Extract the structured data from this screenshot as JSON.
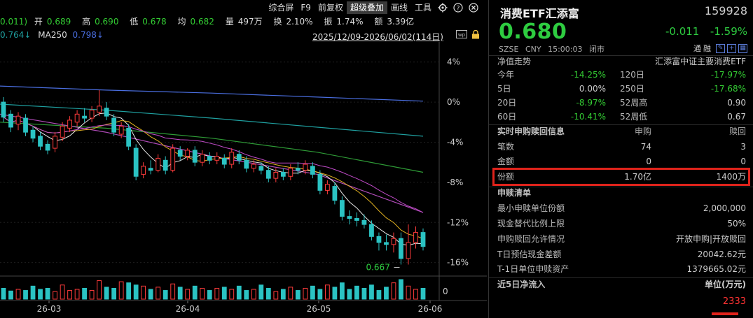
{
  "toolbar": {
    "items": [
      "综合屏",
      "F9",
      "前复权",
      "超级叠加",
      "画线",
      "工具"
    ],
    "active_index": 3,
    "icons": [
      "gear-icon",
      "help-icon",
      "close-icon"
    ]
  },
  "quote": {
    "prev_partial": "0.011)",
    "open_label": "开",
    "open": "0.689",
    "high_label": "高",
    "high": "0.690",
    "low_label": "低",
    "low": "0.678",
    "avg_label": "均",
    "avg": "0.682",
    "vol_label": "量",
    "vol": "497万",
    "turnover_label": "换",
    "turnover": "2.10%",
    "amp_label": "振",
    "amp": "1.74%",
    "amount_label": "额",
    "amount": "3.39亿"
  },
  "ma": {
    "partial_value": "0.764↓",
    "ma250_label": "MA250",
    "ma250_value": "0.798↓"
  },
  "range": {
    "text": "2025/12/09-2026/06/02(114日)",
    "icons": [
      "wp-icon",
      "lock-icon"
    ]
  },
  "axis": {
    "y_ticks": [
      "4%",
      "0%",
      "-4%",
      "-8%",
      "-12%",
      "-16%"
    ],
    "x_ticks": [
      "26-03",
      "26-04",
      "26-05",
      "26-06"
    ],
    "volume_zero": "0",
    "low_marker": "0.667"
  },
  "chart_data": {
    "type": "candlestick",
    "y_range_pct": [
      -17,
      6
    ],
    "candles": [
      {
        "o": 0.0,
        "c": -1.5,
        "h": 0.5,
        "l": -2.0
      },
      {
        "o": -1.2,
        "c": -2.5,
        "h": -0.8,
        "l": -3.0
      },
      {
        "o": -2.2,
        "c": -1.4,
        "h": -1.0,
        "l": -2.8
      },
      {
        "o": -1.6,
        "c": -3.0,
        "h": -1.2,
        "l": -3.4
      },
      {
        "o": -2.8,
        "c": -3.6,
        "h": -2.4,
        "l": -4.0
      },
      {
        "o": -3.4,
        "c": -4.4,
        "h": -3.0,
        "l": -4.8
      },
      {
        "o": -4.2,
        "c": -4.8,
        "h": -3.8,
        "l": -5.2
      },
      {
        "o": -4.6,
        "c": -3.4,
        "h": -3.0,
        "l": -5.0
      },
      {
        "o": -3.5,
        "c": -2.4,
        "h": -2.0,
        "l": -3.9
      },
      {
        "o": -2.6,
        "c": -1.8,
        "h": -1.4,
        "l": -3.0
      },
      {
        "o": -2.0,
        "c": -1.2,
        "h": -0.8,
        "l": -2.4
      },
      {
        "o": -1.4,
        "c": -1.6,
        "h": -0.6,
        "l": -2.0
      },
      {
        "o": -1.6,
        "c": -0.8,
        "h": -0.4,
        "l": -2.0
      },
      {
        "o": -1.0,
        "c": -0.4,
        "h": 1.2,
        "l": -1.4
      },
      {
        "o": -0.6,
        "c": -1.4,
        "h": 0.0,
        "l": -1.8
      },
      {
        "o": -1.6,
        "c": -3.0,
        "h": -1.2,
        "l": -3.4
      },
      {
        "o": -3.2,
        "c": -2.4,
        "h": -2.0,
        "l": -3.6
      },
      {
        "o": -2.6,
        "c": -4.4,
        "h": -2.2,
        "l": -4.8
      },
      {
        "o": -4.6,
        "c": -7.4,
        "h": -4.2,
        "l": -7.8
      },
      {
        "o": -7.2,
        "c": -6.4,
        "h": -6.0,
        "l": -7.6
      },
      {
        "o": -6.6,
        "c": -6.8,
        "h": -5.8,
        "l": -7.2
      },
      {
        "o": -6.8,
        "c": -5.6,
        "h": -5.2,
        "l": -7.0
      },
      {
        "o": -5.8,
        "c": -6.8,
        "h": -5.4,
        "l": -7.2
      },
      {
        "o": -6.8,
        "c": -4.6,
        "h": -4.2,
        "l": -7.0
      },
      {
        "o": -4.8,
        "c": -5.4,
        "h": -4.4,
        "l": -5.8
      },
      {
        "o": -5.4,
        "c": -4.8,
        "h": -4.6,
        "l": -5.8
      },
      {
        "o": -4.8,
        "c": -6.0,
        "h": -4.4,
        "l": -6.4
      },
      {
        "o": -6.0,
        "c": -5.2,
        "h": -4.8,
        "l": -6.4
      },
      {
        "o": -5.4,
        "c": -5.8,
        "h": -5.0,
        "l": -6.2
      },
      {
        "o": -5.8,
        "c": -5.4,
        "h": -5.0,
        "l": -6.2
      },
      {
        "o": -5.6,
        "c": -6.2,
        "h": -5.2,
        "l": -6.6
      },
      {
        "o": -6.2,
        "c": -5.0,
        "h": -4.6,
        "l": -6.6
      },
      {
        "o": -5.2,
        "c": -5.8,
        "h": -4.8,
        "l": -6.2
      },
      {
        "o": -5.8,
        "c": -6.6,
        "h": -5.4,
        "l": -7.0
      },
      {
        "o": -6.6,
        "c": -6.2,
        "h": -5.8,
        "l": -7.0
      },
      {
        "o": -6.4,
        "c": -6.8,
        "h": -6.0,
        "l": -7.2
      },
      {
        "o": -6.8,
        "c": -7.6,
        "h": -6.4,
        "l": -8.0
      },
      {
        "o": -7.6,
        "c": -7.0,
        "h": -6.6,
        "l": -8.0
      },
      {
        "o": -7.0,
        "c": -7.4,
        "h": -6.6,
        "l": -7.8
      },
      {
        "o": -7.4,
        "c": -6.6,
        "h": -6.2,
        "l": -7.8
      },
      {
        "o": -6.6,
        "c": -6.8,
        "h": -6.0,
        "l": -7.2
      },
      {
        "o": -6.8,
        "c": -6.2,
        "h": -5.8,
        "l": -7.2
      },
      {
        "o": -6.4,
        "c": -7.2,
        "h": -6.0,
        "l": -7.6
      },
      {
        "o": -7.2,
        "c": -8.8,
        "h": -6.8,
        "l": -9.2
      },
      {
        "o": -8.8,
        "c": -8.2,
        "h": -7.8,
        "l": -9.2
      },
      {
        "o": -8.4,
        "c": -9.8,
        "h": -8.0,
        "l": -10.2
      },
      {
        "o": -9.8,
        "c": -11.4,
        "h": -9.4,
        "l": -11.8
      },
      {
        "o": -11.4,
        "c": -11.6,
        "h": -10.8,
        "l": -12.2
      },
      {
        "o": -11.6,
        "c": -11.8,
        "h": -11.0,
        "l": -12.4
      },
      {
        "o": -11.8,
        "c": -12.2,
        "h": -11.2,
        "l": -12.6
      },
      {
        "o": -12.2,
        "c": -13.4,
        "h": -11.8,
        "l": -13.8
      },
      {
        "o": -13.4,
        "c": -14.0,
        "h": -13.0,
        "l": -14.8
      },
      {
        "o": -14.0,
        "c": -14.2,
        "h": -13.2,
        "l": -14.8
      },
      {
        "o": -14.2,
        "c": -13.6,
        "h": -13.0,
        "l": -15.0
      },
      {
        "o": -13.6,
        "c": -15.6,
        "h": -13.0,
        "l": -16.2
      },
      {
        "o": -15.6,
        "c": -14.0,
        "h": -12.2,
        "l": -16.2
      },
      {
        "o": -14.0,
        "c": -13.0,
        "h": -12.4,
        "l": -14.6
      },
      {
        "o": -13.0,
        "c": -14.4,
        "h": -12.6,
        "l": -14.8
      }
    ],
    "ma_lines": [
      {
        "color": "#4a6ee0",
        "points": [
          1.6,
          1.2,
          0.9,
          0.5,
          0.1
        ]
      },
      {
        "color": "#1fa0a0",
        "points": [
          -0.2,
          -0.8,
          -1.6,
          -2.5,
          -3.4
        ]
      },
      {
        "color": "#2e9a36",
        "points": [
          -2.0,
          -2.6,
          -3.6,
          -5.0,
          -7.0
        ]
      },
      {
        "color": "#b04bb8",
        "points": [
          -1.2,
          -3.0,
          -5.4,
          -7.2,
          -11.0
        ]
      }
    ],
    "volumes": [
      2.0,
      1.5,
      1.8,
      1.6,
      2.4,
      1.8,
      2.0,
      1.4,
      2.6,
      1.6,
      1.8,
      2.0,
      1.6,
      3.4,
      2.2,
      2.0,
      3.2,
      3.0,
      2.6,
      2.4,
      1.8,
      2.2,
      1.6,
      2.8,
      2.2,
      1.8,
      2.4,
      2.0,
      1.6,
      2.0,
      2.2,
      1.8,
      2.4,
      1.6,
      1.8,
      2.6,
      2.0,
      1.4,
      1.8,
      2.2,
      1.6,
      2.0,
      2.4,
      1.8,
      2.6,
      2.2,
      3.0,
      1.8,
      2.4,
      2.0,
      2.6,
      1.6,
      2.2,
      3.0,
      3.6,
      2.4,
      1.8,
      2.0
    ]
  },
  "info": {
    "fund_name": "消费ETF汇添富",
    "code": "159928",
    "price": "0.680",
    "change": "-0.011",
    "change_pct": "-1.59%",
    "market": "SZSE",
    "currency": "CNY",
    "time": "15:00:03",
    "status": "闭市",
    "tong": "通",
    "rong": "融",
    "nav_label": "净值走势",
    "nav_index": "汇添富中证主要消费ETF",
    "perf": [
      {
        "l1": "今年",
        "v1": "-14.25%",
        "l2": "120日",
        "v2": "-17.97%"
      },
      {
        "l1": "5日",
        "v1": "0.00%",
        "l2": "250日",
        "v2": "-17.68%"
      },
      {
        "l1": "20日",
        "v1": "-8.97%",
        "l2": "52周高",
        "v2": "0.90"
      },
      {
        "l1": "60日",
        "v1": "-10.41%",
        "l2": "52周低",
        "v2": "0.67"
      }
    ],
    "sub_hdr": {
      "a": "实时申购赎回信息",
      "b": "申购",
      "c": "赎回"
    },
    "sub_rows": [
      {
        "a": "笔数",
        "b": "74",
        "c": "3"
      },
      {
        "a": "金额",
        "b": "0",
        "c": "0"
      },
      {
        "a": "份额",
        "b": "1.70亿",
        "c": "1400万"
      }
    ],
    "list_title": "申赎清单",
    "list_rows": [
      {
        "k": "最小申赎单位份额",
        "v": "2,000,000"
      },
      {
        "k": "现金替代比例上限",
        "v": "50%"
      },
      {
        "k": "申购赎回允许情况",
        "v": "开放申购|开放赎回"
      },
      {
        "k": "T日预估现金差额",
        "v": "20042.62元"
      },
      {
        "k": "T-1日单位申赎资产",
        "v": "1379665.02元"
      }
    ],
    "flow_title": "近5日净流入",
    "flow_unit": "单位(万元)",
    "flow_value": "2333"
  }
}
